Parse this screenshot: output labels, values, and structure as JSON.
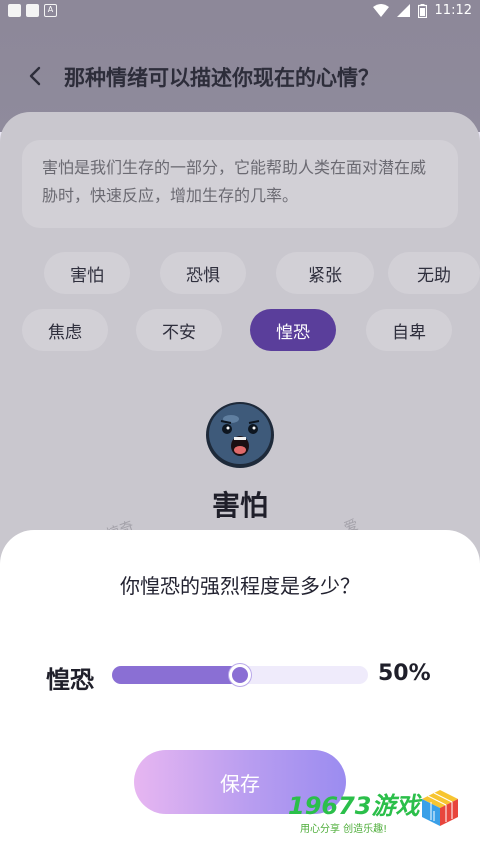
{
  "status_bar": {
    "time": "11:12",
    "icons": [
      "notification-square-icon",
      "notification-square-icon",
      "a-notification-icon",
      "wifi-icon",
      "signal-icon",
      "battery-icon"
    ]
  },
  "header": {
    "title": "那种情绪可以描述你现在的心情？"
  },
  "description": "害怕是我们生存的一部分，它能帮助人类在面对潜在威胁时，快速反应，增加生存的几率。",
  "emotions": {
    "row1": [
      "害怕",
      "恐惧",
      "紧张",
      "无助"
    ],
    "row2": [
      "焦虑",
      "不安",
      "惶恐",
      "自卑"
    ],
    "selected": "惶恐"
  },
  "current_emotion": "害怕",
  "faint_words": [
    "惊奇",
    "爱"
  ],
  "sheet": {
    "question": "你惶恐的强烈程度是多少？",
    "slider_label": "惶恐",
    "slider_percent": 50,
    "slider_value_text": "50%",
    "save_label": "保存"
  },
  "watermark": {
    "title": "19673游戏",
    "subtitle": "用心分享 创造乐趣!"
  },
  "colors": {
    "accent": "#8a6fd4",
    "selected_chip": "#5a3e9b",
    "button_gradient_start": "#e7b6f1",
    "button_gradient_end": "#9b8cf0"
  }
}
